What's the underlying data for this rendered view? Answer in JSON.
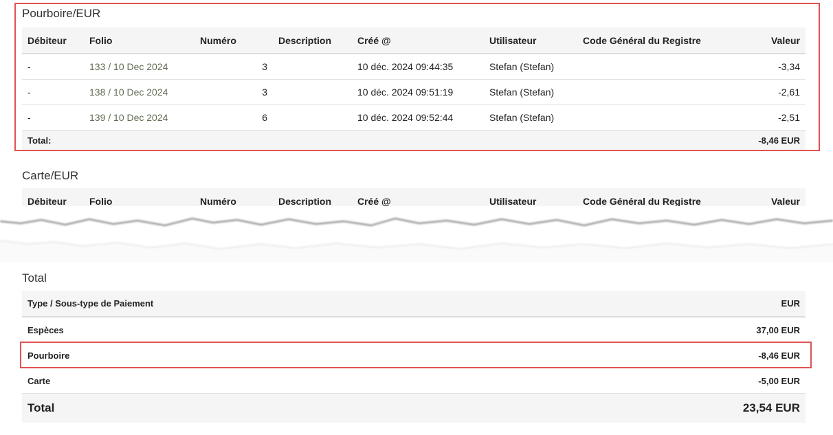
{
  "pourboire": {
    "title": "Pourboire/EUR",
    "headers": {
      "debiteur": "Débiteur",
      "folio": "Folio",
      "numero": "Numéro",
      "description": "Description",
      "cree": "Créé @",
      "utilisateur": "Utilisateur",
      "code": "Code Général du Registre",
      "valeur": "Valeur"
    },
    "rows": [
      {
        "debiteur": "-",
        "folio": "133 / 10 Dec 2024",
        "numero": "3",
        "description": "",
        "cree": "10 déc. 2024 09:44:35",
        "utilisateur": "Stefan (Stefan)",
        "code": "",
        "valeur": "-3,34"
      },
      {
        "debiteur": "-",
        "folio": "138 / 10 Dec 2024",
        "numero": "3",
        "description": "",
        "cree": "10 déc. 2024 09:51:19",
        "utilisateur": "Stefan (Stefan)",
        "code": "",
        "valeur": "-2,61"
      },
      {
        "debiteur": "-",
        "folio": "139 / 10 Dec 2024",
        "numero": "6",
        "description": "",
        "cree": "10 déc. 2024 09:52:44",
        "utilisateur": "Stefan (Stefan)",
        "code": "",
        "valeur": "-2,51"
      }
    ],
    "total_label": "Total:",
    "total_value": "-8,46 EUR"
  },
  "carte": {
    "title": "Carte/EUR",
    "headers": {
      "debiteur": "Débiteur",
      "folio": "Folio",
      "numero": "Numéro",
      "description": "Description",
      "cree": "Créé @",
      "utilisateur": "Utilisateur",
      "code": "Code Général du Registre",
      "valeur": "Valeur"
    }
  },
  "summary": {
    "title": "Total",
    "header_type": "Type / Sous-type de Paiement",
    "header_currency": "EUR",
    "rows": [
      {
        "label": "Espèces",
        "value": "37,00 EUR"
      },
      {
        "label": "Pourboire",
        "value": "-8,46 EUR"
      },
      {
        "label": "Carte",
        "value": "-5,00 EUR"
      }
    ],
    "grand_label": "Total",
    "grand_value": "23,54 EUR"
  },
  "colors": {
    "highlight": "#e05252",
    "header_bg": "#f5f5f5",
    "folio_link": "#5f6b52"
  }
}
